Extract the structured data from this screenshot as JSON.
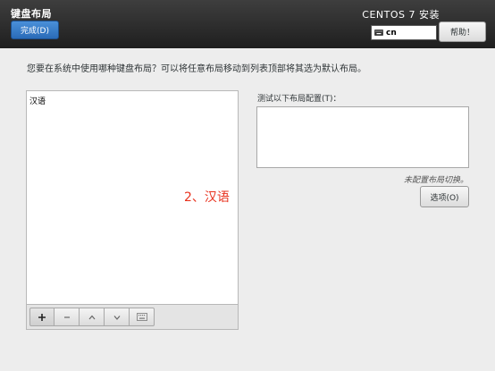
{
  "header": {
    "title": "键盘布局",
    "done_label": "完成(D)",
    "product_title": "CENTOS 7 安装",
    "keyboard_indicator": {
      "icon": "keyboard-icon",
      "code": "cn"
    },
    "help_label": "帮助！"
  },
  "instruction": "您要在系统中使用哪种键盘布局？可以将任意布局移动到列表顶部将其选为默认布局。",
  "layout_list": {
    "items": [
      {
        "label": "汉语"
      }
    ]
  },
  "toolbar": {
    "buttons": [
      {
        "icon": "add-icon"
      },
      {
        "icon": "remove-icon"
      },
      {
        "icon": "move-up-icon"
      },
      {
        "icon": "move-down-icon"
      },
      {
        "icon": "keyboard-preview-icon"
      }
    ]
  },
  "annotation": "2、汉语",
  "test_panel": {
    "label": "测试以下布局配置(T)：",
    "value": "",
    "switch_status": "未配置布局切换。",
    "options_label": "选项(O)"
  },
  "colors": {
    "header_bg": "#2b2b2b",
    "done_button": "#3a7bd0",
    "annotation": "#e8321e",
    "page_bg": "#ededed"
  }
}
